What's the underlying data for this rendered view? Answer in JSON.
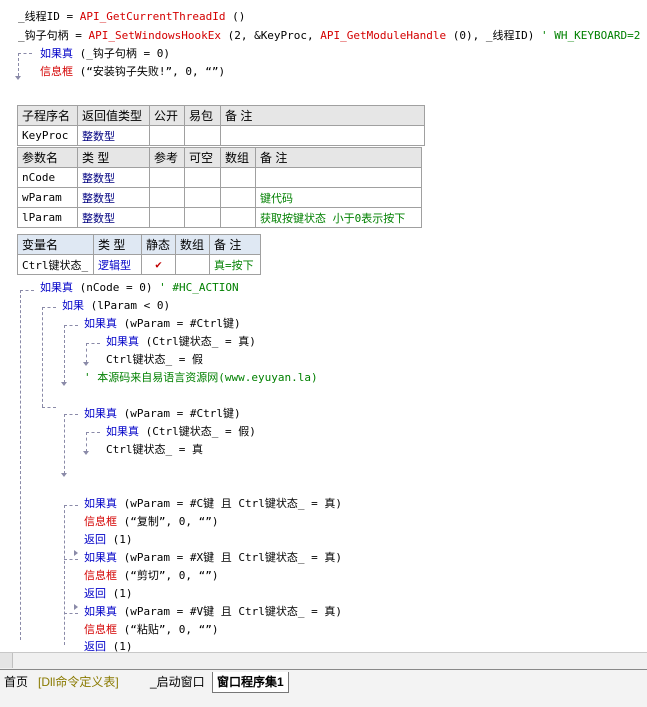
{
  "code_top": {
    "l1_var": "_线程ID = ",
    "l1_func": "API_GetCurrentThreadId",
    "l1_rest": " ()",
    "l2_var": "_钩子句柄 = ",
    "l2_func": "API_SetWindowsHookEx",
    "l2_args": " (2, &KeyProc, ",
    "l2_func2": "API_GetModuleHandle",
    "l2_rest": " (0), _线程ID) ",
    "l2_comment": "' WH_KEYBOARD=2",
    "l3_kw": "如果真",
    "l3_rest": " (_钩子句柄 = 0)",
    "l4_kw": "信息框",
    "l4_rest": " (“安装钩子失败!”, 0, “”)"
  },
  "sub_table": {
    "headers": [
      "子程序名",
      "返回值类型",
      "公开",
      "易包",
      "备 注"
    ],
    "row": [
      "KeyProc",
      "整数型",
      "",
      "",
      ""
    ]
  },
  "param_table": {
    "headers": [
      "参数名",
      "类 型",
      "参考",
      "可空",
      "数组",
      "备 注"
    ],
    "rows": [
      [
        "nCode",
        "整数型",
        "",
        "",
        "",
        ""
      ],
      [
        "wParam",
        "整数型",
        "",
        "",
        "",
        "键代码"
      ],
      [
        "lParam",
        "整数型",
        "",
        "",
        "",
        "获取按键状态 小于0表示按下"
      ]
    ]
  },
  "var_table": {
    "headers": [
      "变量名",
      "类 型",
      "静态",
      "数组",
      "备 注"
    ],
    "row": [
      "Ctrl键状态_",
      "逻辑型",
      "✔",
      "",
      "真=按下"
    ]
  },
  "code_body": {
    "b1_kw": "如果真",
    "b1_rest": " (nCode = 0) ",
    "b1_comment": "' #HC_ACTION",
    "b2_kw": "如果",
    "b2_rest": " (lParam < 0)",
    "b3_kw": "如果真",
    "b3_rest": " (wParam = #Ctrl键)",
    "b4_kw": "如果真",
    "b4_rest": " (Ctrl键状态_ = 真)",
    "b5": "Ctrl键状态_ = 假",
    "b6": "' 本源码来自易语言资源网(www.eyuyan.la)",
    "b7_kw": "如果真",
    "b7_rest": " (wParam = #Ctrl键)",
    "b8_kw": "如果真",
    "b8_rest": " (Ctrl键状态_ = 假)",
    "b9": "Ctrl键状态_ = 真",
    "c1_kw": "如果真",
    "c1_rest": " (wParam = #C键 且 Ctrl键状态_ = 真)",
    "c2_kw": "信息框",
    "c2_rest": " (“复制”, 0, “”)",
    "c3_kw": "返回",
    "c3_rest": " (1)",
    "x1_kw": "如果真",
    "x1_rest": " (wParam = #X键 且 Ctrl键状态_ = 真)",
    "x2_kw": "信息框",
    "x2_rest": " (“剪切”, 0, “”)",
    "x3_kw": "返回",
    "x3_rest": " (1)",
    "v1_kw": "如果真",
    "v1_rest": " (wParam = #V键 且 Ctrl键状态_ = 真)",
    "v2_kw": "信息框",
    "v2_rest": " (“粘贴”, 0, “”)",
    "v3_kw": "返回",
    "v3_rest": " (1)"
  },
  "tabs": [
    "首页",
    "[Dll命令定义表]",
    "_启动窗口",
    "窗口程序集1"
  ]
}
